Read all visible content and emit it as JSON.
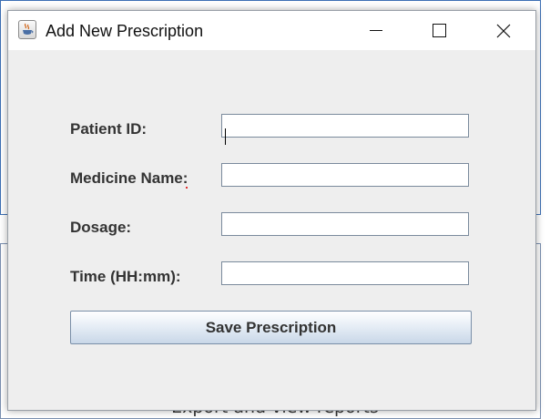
{
  "background": {
    "partial_text": "Export and view reports"
  },
  "dialog": {
    "title": "Add New Prescription",
    "icon": "java-cup-icon",
    "controls": [
      "minimize-icon",
      "maximize-icon",
      "close-icon"
    ]
  },
  "form": {
    "fields": [
      {
        "label": "Patient ID:",
        "value": "",
        "placeholder": ""
      },
      {
        "label": "Medicine Name:",
        "value": "",
        "placeholder": ""
      },
      {
        "label": "Dosage:",
        "value": "",
        "placeholder": ""
      },
      {
        "label": "Time (HH:mm):",
        "value": "",
        "placeholder": ""
      }
    ],
    "save_label": "Save Prescription"
  },
  "colors": {
    "dialog_bg": "#eeeeee",
    "titlebar_bg": "#ffffff",
    "label_text": "#333333",
    "button_gradient_bottom": "#c9d7e8",
    "field_border": "#7a8a9c"
  }
}
